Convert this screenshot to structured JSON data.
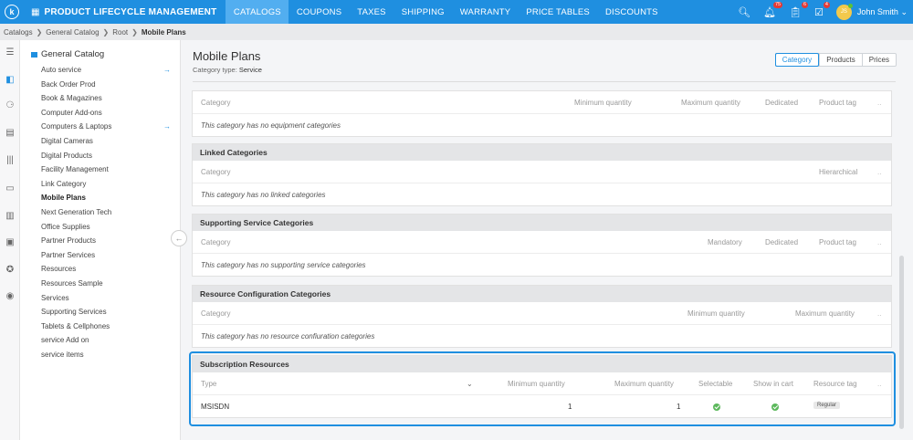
{
  "topbar": {
    "logo_letter": "k",
    "app_title": "PRODUCT LIFECYCLE MANAGEMENT",
    "nav": [
      "CATALOGS",
      "COUPONS",
      "TAXES",
      "SHIPPING",
      "WARRANTY",
      "PRICE TABLES",
      "DISCOUNTS"
    ],
    "active_nav": "CATALOGS",
    "notifications_count": "75",
    "tasks_count": "6",
    "approvals_count": "4",
    "avatar_initials": "JS",
    "username": "John Smith"
  },
  "breadcrumb": [
    "Catalogs",
    "General Catalog",
    "Root",
    "Mobile Plans"
  ],
  "sidebar": {
    "root": "General Catalog",
    "items": [
      {
        "label": "Auto service",
        "has_arrow": true
      },
      {
        "label": "Back Order Prod"
      },
      {
        "label": "Book & Magazines"
      },
      {
        "label": "Computer Add-ons"
      },
      {
        "label": "Computers & Laptops",
        "has_arrow": true
      },
      {
        "label": "Digital Cameras"
      },
      {
        "label": "Digital Products"
      },
      {
        "label": "Facility Management"
      },
      {
        "label": "Link Category"
      },
      {
        "label": "Mobile Plans",
        "selected": true
      },
      {
        "label": "Next Generation Tech"
      },
      {
        "label": "Office Supplies"
      },
      {
        "label": "Partner Products"
      },
      {
        "label": "Partner Services"
      },
      {
        "label": "Resources"
      },
      {
        "label": "Resources Sample"
      },
      {
        "label": "Services"
      },
      {
        "label": "Supporting Services"
      },
      {
        "label": "Tablets & Cellphones"
      },
      {
        "label": "service Add on"
      },
      {
        "label": "service items"
      }
    ]
  },
  "main": {
    "title": "Mobile Plans",
    "subtitle_label": "Category type:",
    "subtitle_value": "Service",
    "view_tabs": [
      "Category",
      "Products",
      "Prices"
    ],
    "active_view_tab": "Category",
    "equipment": {
      "columns": [
        "Category",
        "Minimum quantity",
        "Maximum quantity",
        "Dedicated",
        "Product tag",
        ".."
      ],
      "empty": "This category has no equipment categories"
    },
    "linked": {
      "title": "Linked Categories",
      "columns": [
        "Category",
        "Hierarchical",
        ".."
      ],
      "empty": "This category has no linked categories"
    },
    "supporting": {
      "title": "Supporting Service Categories",
      "columns": [
        "Category",
        "Mandatory",
        "Dedicated",
        "Product tag",
        ".."
      ],
      "empty": "This category has no supporting service categories"
    },
    "resource_config": {
      "title": "Resource Configuration Categories",
      "columns": [
        "Category",
        "Minimum quantity",
        "Maximum quantity",
        ".."
      ],
      "empty": "This category has no resource confiuration categories"
    },
    "subscription": {
      "title": "Subscription Resources",
      "columns": [
        "Type",
        "Minimum quantity",
        "Maximum quantity",
        "Selectable",
        "Show in cart",
        "Resource tag",
        ".."
      ],
      "rows": [
        {
          "type": "MSISDN",
          "min": "1",
          "max": "1",
          "selectable": true,
          "show_in_cart": true,
          "tag": "Regular"
        }
      ]
    }
  },
  "colors": {
    "accent": "#1f8fe0",
    "check": "#5cb85c",
    "badge": "#e53935"
  }
}
